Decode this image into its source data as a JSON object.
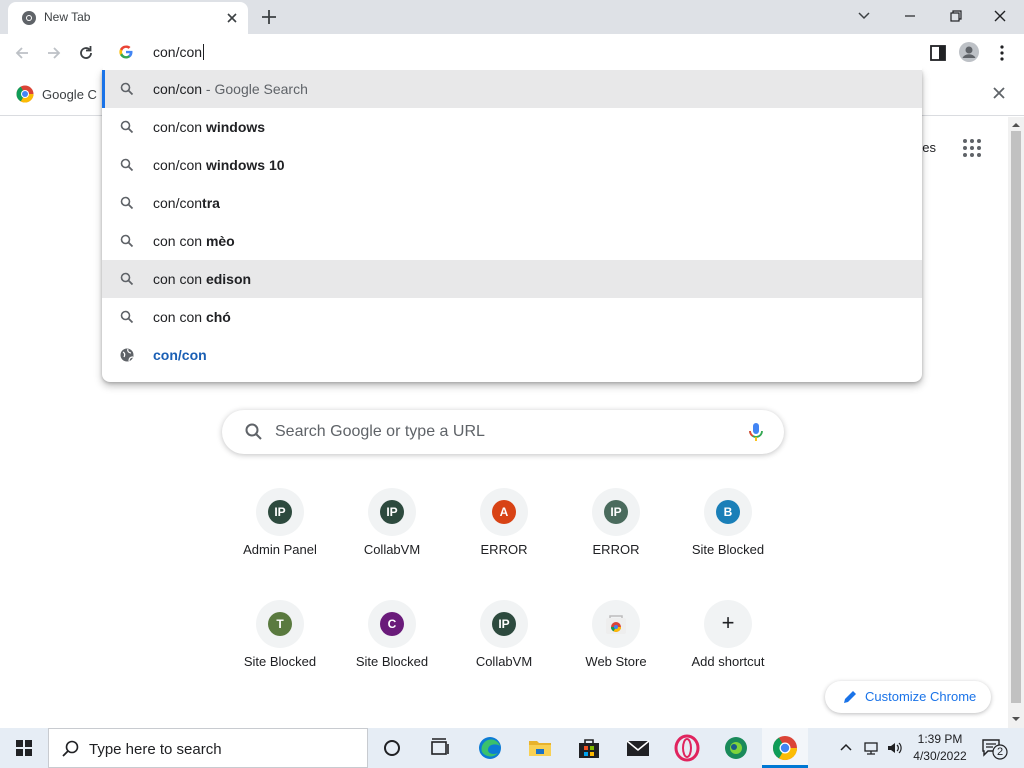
{
  "browser": {
    "tab_title": "New Tab",
    "omnibox_text": "con/con",
    "bookmark_label": "Google C",
    "colors": {
      "accent": "#1a73e8",
      "selected_row": "#e8e8e9",
      "titlebar": "#dee1e6"
    }
  },
  "suggestions": [
    {
      "prefix": "con/con",
      "bold": "",
      "suffix": " - Google Search",
      "icon": "search-icon"
    },
    {
      "prefix": "con/con ",
      "bold": "windows",
      "suffix": "",
      "icon": "search-icon"
    },
    {
      "prefix": "con/con ",
      "bold": "windows 10",
      "suffix": "",
      "icon": "search-icon"
    },
    {
      "prefix": "con/con",
      "bold": "tra",
      "suffix": "",
      "icon": "search-icon"
    },
    {
      "prefix": "con con ",
      "bold": "mèo",
      "suffix": "",
      "icon": "search-icon"
    },
    {
      "prefix": "con con ",
      "bold": "edison",
      "suffix": "",
      "icon": "search-icon"
    },
    {
      "prefix": "con con ",
      "bold": "chó",
      "suffix": "",
      "icon": "search-icon"
    },
    {
      "prefix": "",
      "bold": "con/con",
      "suffix": "",
      "icon": "globe-icon"
    }
  ],
  "ntp": {
    "partial_link": "ges",
    "search_placeholder": "Search Google or type a URL",
    "shortcuts": [
      {
        "letter": "IP",
        "label": "Admin Panel",
        "color": "#2d4a3e"
      },
      {
        "letter": "IP",
        "label": "CollabVM",
        "color": "#2d4a3e"
      },
      {
        "letter": "A",
        "label": "ERROR",
        "color": "#d84315"
      },
      {
        "letter": "IP",
        "label": "ERROR",
        "color": "#4a6b5d"
      },
      {
        "letter": "B",
        "label": "Site Blocked",
        "color": "#1a7fb8"
      },
      {
        "letter": "T",
        "label": "Site Blocked",
        "color": "#5a7a3f"
      },
      {
        "letter": "C",
        "label": "Site Blocked",
        "color": "#6a1b7a"
      },
      {
        "letter": "IP",
        "label": "CollabVM",
        "color": "#2d4a3e"
      },
      {
        "letter": "",
        "label": "Web Store",
        "color": "#ffffff"
      },
      {
        "letter": "+",
        "label": "Add shortcut",
        "color": "#f1f3f4"
      }
    ],
    "customize_label": "Customize Chrome"
  },
  "taskbar": {
    "search_text": "Type here to search",
    "time": "1:39 PM",
    "date": "4/30/2022",
    "notification_count": "2"
  }
}
